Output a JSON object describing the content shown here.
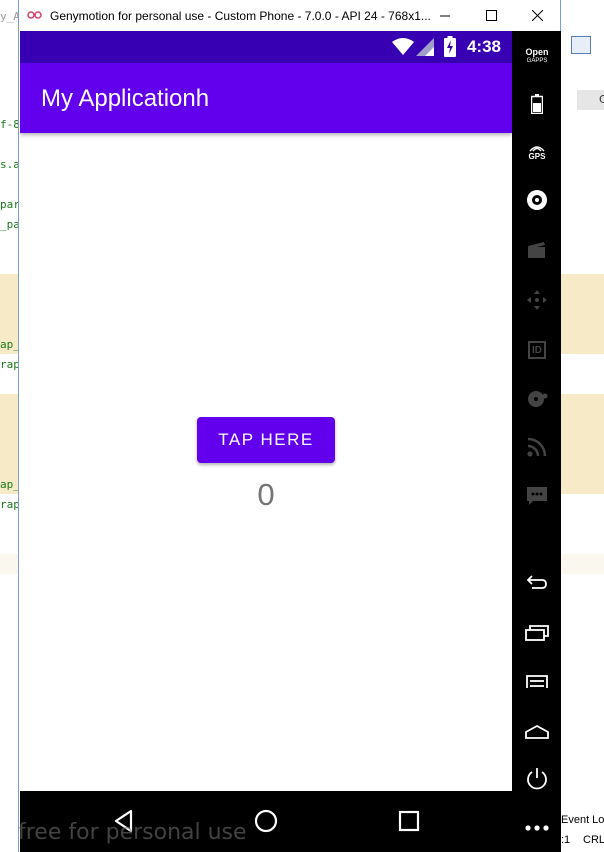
{
  "ide": {
    "left_lines": [
      "y_A",
      "f-8",
      "s.a",
      "par",
      "_pa",
      "ap_",
      "rap",
      "ap_",
      "rap"
    ],
    "right_lines": [
      "C",
      "Event Lo",
      ":1",
      "CRL"
    ]
  },
  "window": {
    "title": "Genymotion for personal use - Custom Phone - 7.0.0 - API 24 - 768x1..."
  },
  "status_bar": {
    "time": "4:38"
  },
  "app": {
    "title": "My Applicationh",
    "button_label": "TAP HERE",
    "counter": "0"
  },
  "panel": {
    "open_gapps_line1": "Open",
    "open_gapps_line2": "GAPPS",
    "gps_label": "GPS",
    "id_label": "ID",
    "items": [
      "open-gapps-icon",
      "battery-icon",
      "gps-icon",
      "camera-icon",
      "capture-icon",
      "dpad-icon",
      "device-id-icon",
      "disk-icon",
      "network-icon",
      "sms-icon",
      "back-icon",
      "recent-apps-icon",
      "menu-icon",
      "home-icon",
      "power-icon",
      "more-icon"
    ]
  },
  "watermark": "free for personal use",
  "colors": {
    "primary": "#6200ee",
    "primary_dark": "#3700b3",
    "counter_text": "#757575"
  }
}
